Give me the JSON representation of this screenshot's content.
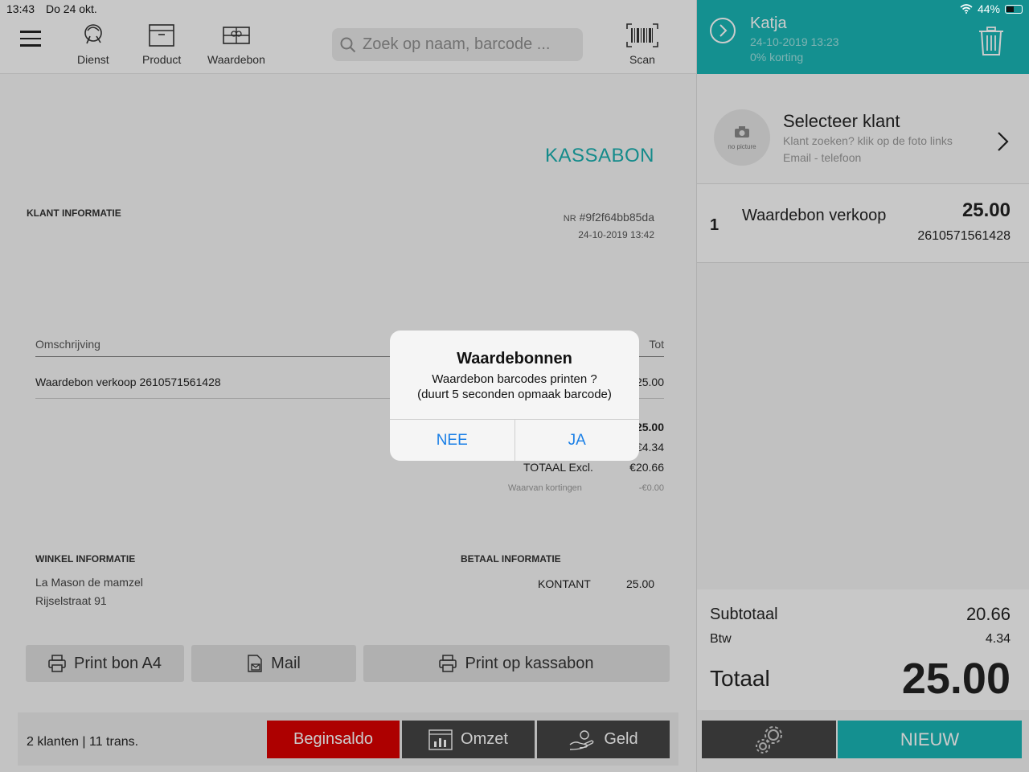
{
  "status": {
    "time": "13:43",
    "date": "Do 24 okt.",
    "battery": "44%"
  },
  "toolbar": {
    "items": [
      {
        "label": "Dienst",
        "icon": "service-icon"
      },
      {
        "label": "Product",
        "icon": "box-icon"
      },
      {
        "label": "Waardebon",
        "icon": "voucher-icon"
      }
    ],
    "search_placeholder": "Zoek op naam, barcode ...",
    "scan_label": "Scan"
  },
  "receipt": {
    "title": "KASSABON",
    "klant_info": "KLANT INFORMATIE",
    "nr_prefix": "NR",
    "nr": "#9f2f64bb85da",
    "datetime": "24-10-2019 13:42",
    "col_desc": "Omschrijving",
    "col_total": "Tot",
    "line_desc": "Waardebon verkoop 2610571561428",
    "line_total": "25.00",
    "total_partial": "25.00",
    "btw_partial": "€4.34",
    "totaal_excl_label": "TOTAAL Excl.",
    "totaal_excl_value": "€20.66",
    "kortingen_label": "Waarvan kortingen",
    "kortingen_value": "-€0.00",
    "winkel_heading": "WINKEL INFORMATIE",
    "winkel_name": "La Mason de mamzel",
    "winkel_street": "Rijselstraat 91",
    "betaal_heading": "BETAAL INFORMATIE",
    "betaal_method": "KONTANT",
    "betaal_amount": "25.00"
  },
  "actions": {
    "print_a4": "Print bon A4",
    "mail": "Mail",
    "print_kassabon": "Print op kassabon"
  },
  "bottombar": {
    "info": "2 klanten | 11 trans.",
    "beginsaldo": "Beginsaldo",
    "omzet": "Omzet",
    "geld": "Geld"
  },
  "order": {
    "customer_name": "Katja",
    "datetime": "24-10-2019 13:23",
    "discount": "0% korting",
    "select_title": "Selecteer klant",
    "select_hint": "Klant zoeken? klik op de foto links",
    "select_contact": "Email - telefoon",
    "avatar_label": "no picture",
    "item_qty": "1",
    "item_name": "Waardebon verkoop",
    "item_price": "25.00",
    "item_code": "2610571561428",
    "subtotal_label": "Subtotaal",
    "subtotal": "20.66",
    "btw_label": "Btw",
    "btw": "4.34",
    "total_label": "Totaal",
    "total": "25.00",
    "new_label": "NIEUW"
  },
  "dialog": {
    "title": "Waardebonnen",
    "message_line1": "Waardebon barcodes printen ?",
    "message_line2": "(duurt 5 seconden opmaak barcode)",
    "no": "NEE",
    "yes": "JA"
  },
  "colors": {
    "accent": "#1ab5b5",
    "danger": "#d90000",
    "dark": "#444444",
    "link": "#1a7fe6"
  }
}
